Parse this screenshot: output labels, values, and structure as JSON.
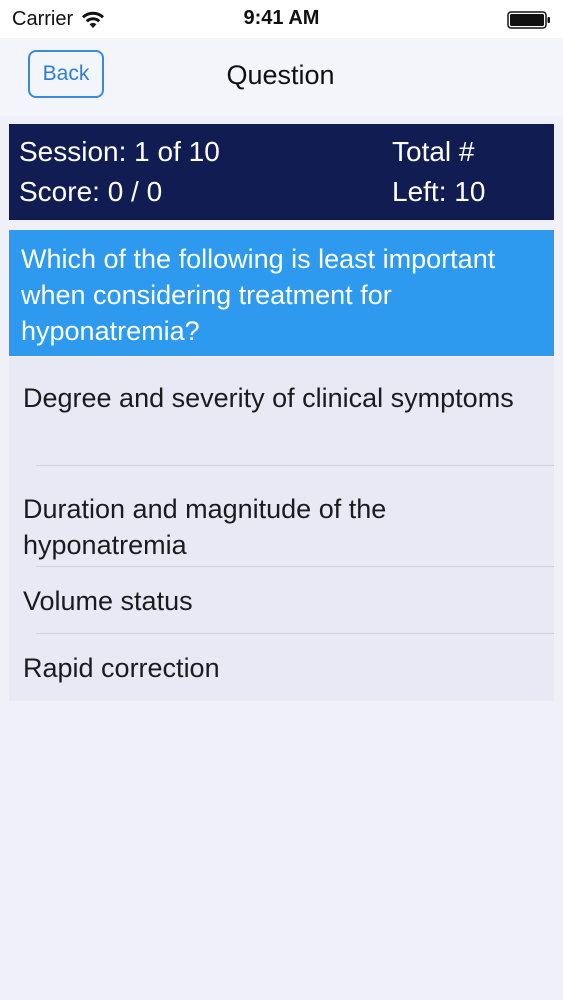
{
  "status_bar": {
    "carrier": "Carrier",
    "time": "9:41 AM",
    "icons": [
      "wifi-icon",
      "battery-icon"
    ]
  },
  "nav": {
    "back_label": "Back",
    "title": "Question"
  },
  "session": {
    "session_text": "Session: 1 of 10",
    "score_text": "Score: 0 / 0",
    "total_text": "Total #",
    "left_text": "Left: 10"
  },
  "question": {
    "text": "Which of the following is least important when considering treatment for hyponatremia?"
  },
  "answers": [
    {
      "text": "Degree and severity of clinical symptoms"
    },
    {
      "text": "Duration and magnitude of the hyponatremia"
    },
    {
      "text": "Volume status"
    },
    {
      "text": "Rapid correction"
    }
  ],
  "colors": {
    "header_bg": "#111c52",
    "question_bg": "#2d9af0",
    "accent": "#2a7fd4",
    "background": "#eff0f8"
  }
}
